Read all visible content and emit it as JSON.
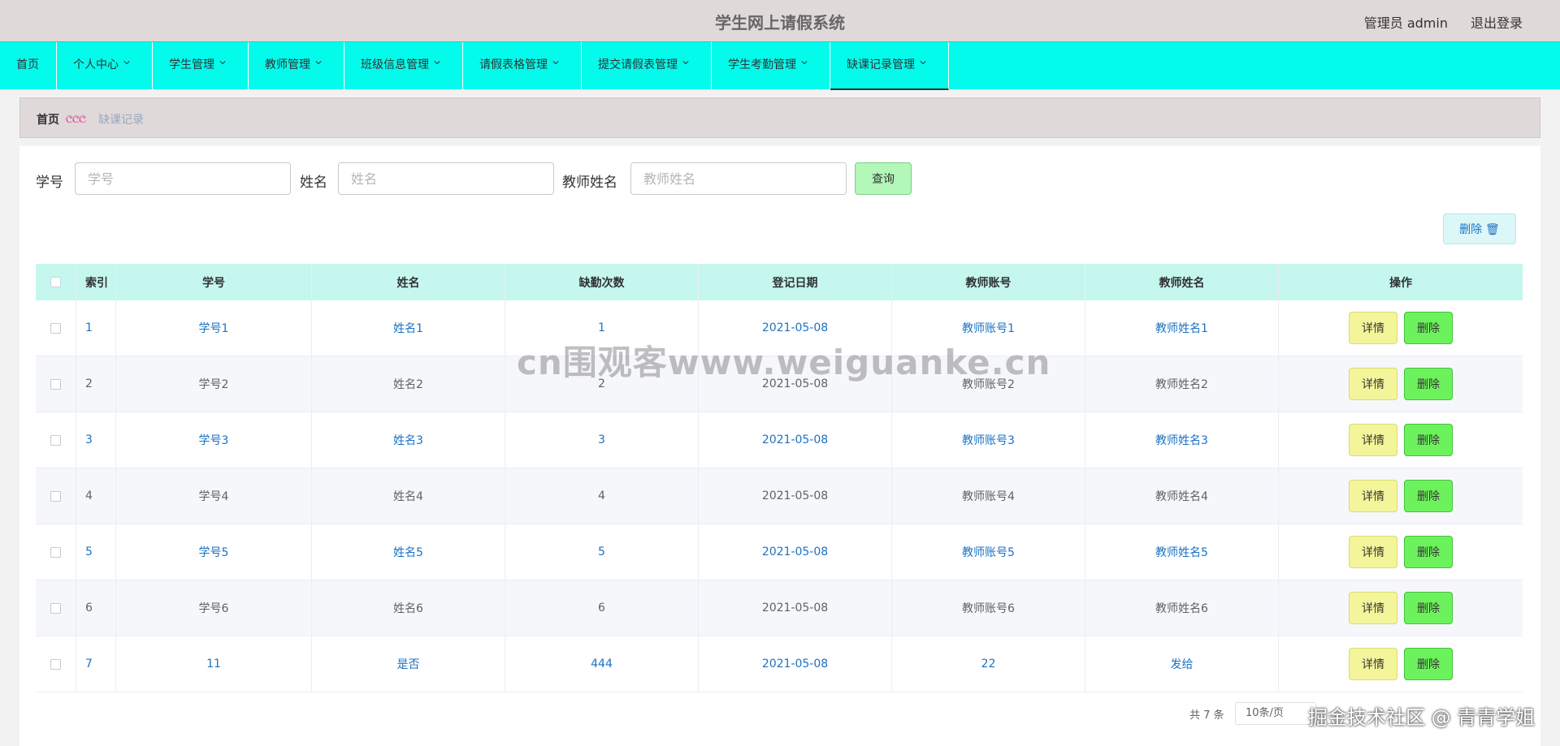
{
  "header": {
    "title": "学生网上请假系统",
    "admin_label": "管理员 admin",
    "logout_label": "退出登录"
  },
  "nav": {
    "items": [
      {
        "label": "首页"
      },
      {
        "label": "个人中心"
      },
      {
        "label": "学生管理"
      },
      {
        "label": "教师管理"
      },
      {
        "label": "班级信息管理"
      },
      {
        "label": "请假表格管理"
      },
      {
        "label": "提交请假表管理"
      },
      {
        "label": "学生考勤管理"
      },
      {
        "label": "缺课记录管理"
      }
    ],
    "active_index": 8
  },
  "breadcrumb": {
    "home": "首页",
    "separator": "ලලල",
    "current": "缺课记录"
  },
  "search": {
    "student_id_label": "学号",
    "student_id_placeholder": "学号",
    "name_label": "姓名",
    "name_placeholder": "姓名",
    "teacher_name_label": "教师姓名",
    "teacher_name_placeholder": "教师姓名",
    "query_label": "查询"
  },
  "toolbar": {
    "delete_label": "删除 🗑"
  },
  "table": {
    "headers": [
      "索引",
      "学号",
      "姓名",
      "缺勤次数",
      "登记日期",
      "教师账号",
      "教师姓名",
      "操作"
    ],
    "detail_label": "详情",
    "delete_label": "删除",
    "rows": [
      {
        "index": "1",
        "student_id": "学号1",
        "name": "姓名1",
        "absences": "1",
        "date": "2021-05-08",
        "teacher_account": "教师账号1",
        "teacher_name": "教师姓名1"
      },
      {
        "index": "2",
        "student_id": "学号2",
        "name": "姓名2",
        "absences": "2",
        "date": "2021-05-08",
        "teacher_account": "教师账号2",
        "teacher_name": "教师姓名2"
      },
      {
        "index": "3",
        "student_id": "学号3",
        "name": "姓名3",
        "absences": "3",
        "date": "2021-05-08",
        "teacher_account": "教师账号3",
        "teacher_name": "教师姓名3"
      },
      {
        "index": "4",
        "student_id": "学号4",
        "name": "姓名4",
        "absences": "4",
        "date": "2021-05-08",
        "teacher_account": "教师账号4",
        "teacher_name": "教师姓名4"
      },
      {
        "index": "5",
        "student_id": "学号5",
        "name": "姓名5",
        "absences": "5",
        "date": "2021-05-08",
        "teacher_account": "教师账号5",
        "teacher_name": "教师姓名5"
      },
      {
        "index": "6",
        "student_id": "学号6",
        "name": "姓名6",
        "absences": "6",
        "date": "2021-05-08",
        "teacher_account": "教师账号6",
        "teacher_name": "教师姓名6"
      },
      {
        "index": "7",
        "student_id": "11",
        "name": "是否",
        "absences": "444",
        "date": "2021-05-08",
        "teacher_account": "22",
        "teacher_name": "发给"
      }
    ]
  },
  "pagination": {
    "total": "共 7 条",
    "page_size": "10条/页"
  },
  "watermarks": {
    "center": "cn围观客www.weiguanke.cn",
    "corner": "掘金技术社区 @ 青青学姐"
  },
  "colors": {
    "nav_bg": "#03fbec",
    "header_bg": "#e0d9d9",
    "link_blue": "#1b72c4",
    "table_head_bg": "#c5f7ef",
    "detail_button": "#f4f59a",
    "delete_button": "#6cf25c",
    "query_button": "#b3f7b9",
    "breadcrumb_separator": "#e2127b"
  }
}
